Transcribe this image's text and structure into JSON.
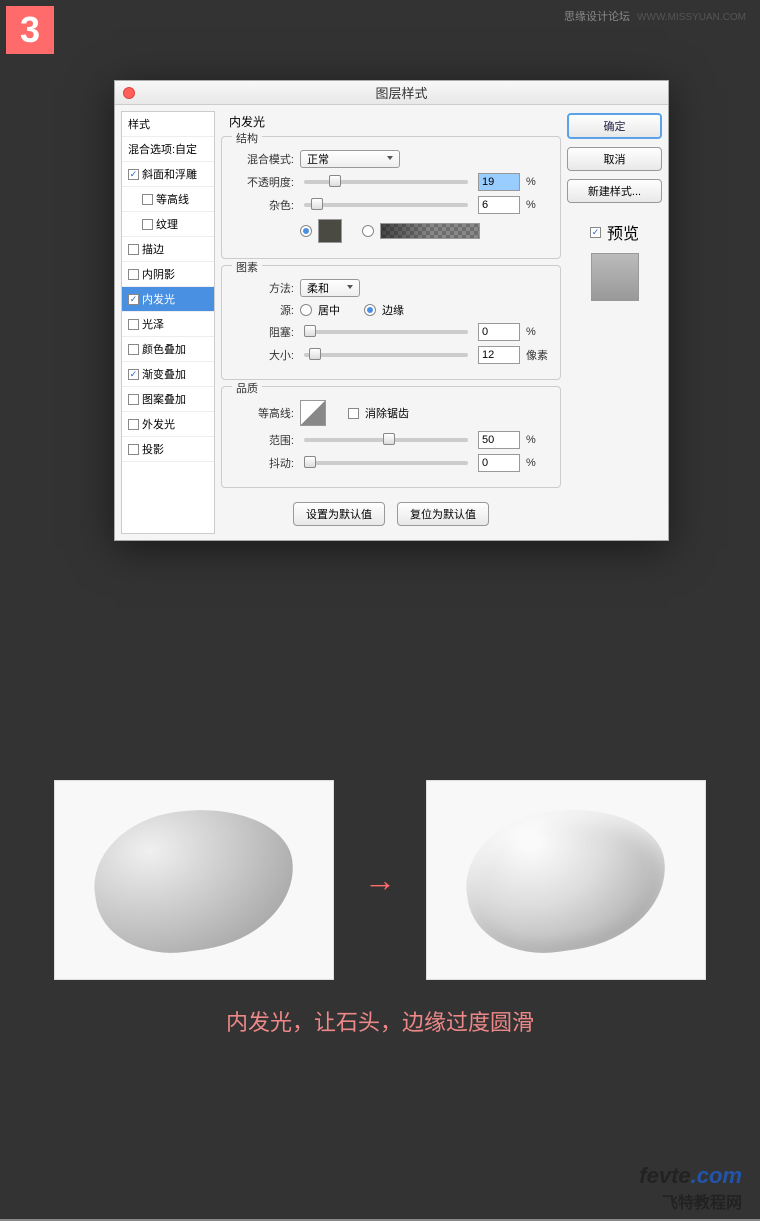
{
  "badge": "3",
  "watermark": {
    "text": "思缘设计论坛",
    "url": "WWW.MISSYUAN.COM"
  },
  "dialog": {
    "title": "图层样式",
    "sidebar": {
      "header1": "样式",
      "header2": "混合选项:自定",
      "items": [
        {
          "label": "斜面和浮雕",
          "checked": true,
          "sub": false
        },
        {
          "label": "等高线",
          "checked": false,
          "sub": true
        },
        {
          "label": "纹理",
          "checked": false,
          "sub": true
        },
        {
          "label": "描边",
          "checked": false,
          "sub": false
        },
        {
          "label": "内阴影",
          "checked": false,
          "sub": false
        },
        {
          "label": "内发光",
          "checked": true,
          "sub": false,
          "selected": true
        },
        {
          "label": "光泽",
          "checked": false,
          "sub": false
        },
        {
          "label": "颜色叠加",
          "checked": false,
          "sub": false
        },
        {
          "label": "渐变叠加",
          "checked": true,
          "sub": false
        },
        {
          "label": "图案叠加",
          "checked": false,
          "sub": false
        },
        {
          "label": "外发光",
          "checked": false,
          "sub": false
        },
        {
          "label": "投影",
          "checked": false,
          "sub": false
        }
      ]
    },
    "panel_title": "内发光",
    "structure": {
      "legend": "结构",
      "blend_mode": {
        "label": "混合模式:",
        "value": "正常"
      },
      "opacity": {
        "label": "不透明度:",
        "value": "19",
        "unit": "%"
      },
      "noise": {
        "label": "杂色:",
        "value": "6",
        "unit": "%"
      }
    },
    "elements": {
      "legend": "图素",
      "method": {
        "label": "方法:",
        "value": "柔和"
      },
      "source": {
        "label": "源:",
        "center": "居中",
        "edge": "边缘"
      },
      "choke": {
        "label": "阻塞:",
        "value": "0",
        "unit": "%"
      },
      "size": {
        "label": "大小:",
        "value": "12",
        "unit": "像素"
      }
    },
    "quality": {
      "legend": "品质",
      "contour": {
        "label": "等高线:",
        "antialias": "消除锯齿"
      },
      "range": {
        "label": "范围:",
        "value": "50",
        "unit": "%"
      },
      "jitter": {
        "label": "抖动:",
        "value": "0",
        "unit": "%"
      }
    },
    "buttons": {
      "ok": "确定",
      "cancel": "取消",
      "new_style": "新建样式...",
      "preview": "预览",
      "make_default": "设置为默认值",
      "reset_default": "复位为默认值"
    }
  },
  "caption": "内发光，让石头，边缘过度圆滑",
  "footer": {
    "main1": "fevte",
    "main2": ".com",
    "sub": "飞特教程网"
  }
}
